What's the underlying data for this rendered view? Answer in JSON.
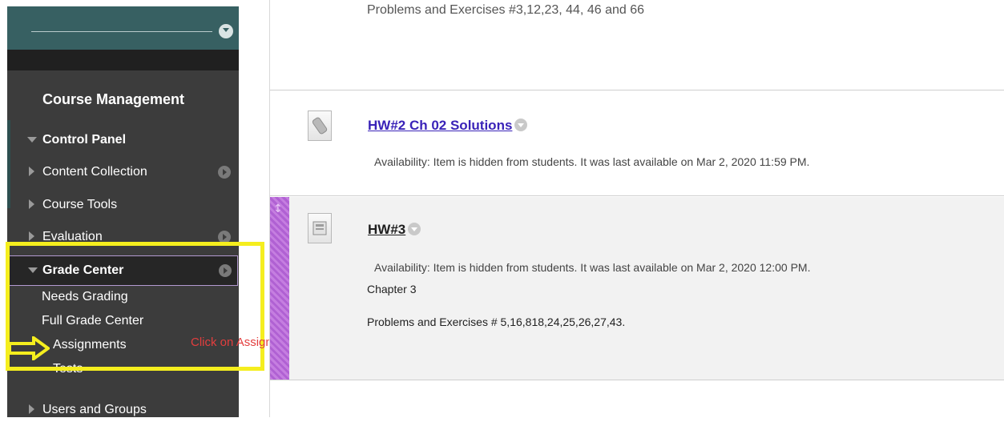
{
  "sidebar": {
    "heading": "Course Management",
    "items": [
      {
        "label": "Control Panel"
      },
      {
        "label": "Content Collection"
      },
      {
        "label": "Course Tools"
      },
      {
        "label": "Evaluation"
      },
      {
        "label": "Grade Center"
      },
      {
        "label": "Users and Groups"
      }
    ],
    "grade_center_children": [
      "Needs Grading",
      "Full Grade Center",
      "Assignments",
      "Tests"
    ]
  },
  "annotation": {
    "text": "Click on Assignmnet",
    "highlight_color": "#f5ee1e",
    "text_color": "#e33e3e"
  },
  "content": {
    "top_snippet": "Problems and Exercises   #3,12,23, 44, 46 and 66",
    "items": [
      {
        "title": "HW#2 Ch 02 Solutions",
        "availability": "Availability:   Item is hidden from students. It was last available on Mar 2, 2020 11:59 PM."
      },
      {
        "title": "HW#3",
        "availability": "Availability:   Item is hidden from students. It was last available on Mar 2, 2020 12:00 PM.",
        "chapter": "Chapter 3",
        "problems": "Problems and Exercises #  5,16,818,24,25,26,27,43."
      }
    ]
  },
  "colors": {
    "nav_background": "#3c3c3c",
    "nav_header": "#376062",
    "link": "#3a23b8",
    "drag_bar": "#c57ee0"
  },
  "icons": {
    "nav_collapse": "chevron-down-icon",
    "nav_item_arrow": "arrow-right-circle-icon",
    "file_item": "file-attachment-icon",
    "assignment_item": "assignment-icon",
    "annotation_pointer": "yellow-arrow-icon"
  }
}
